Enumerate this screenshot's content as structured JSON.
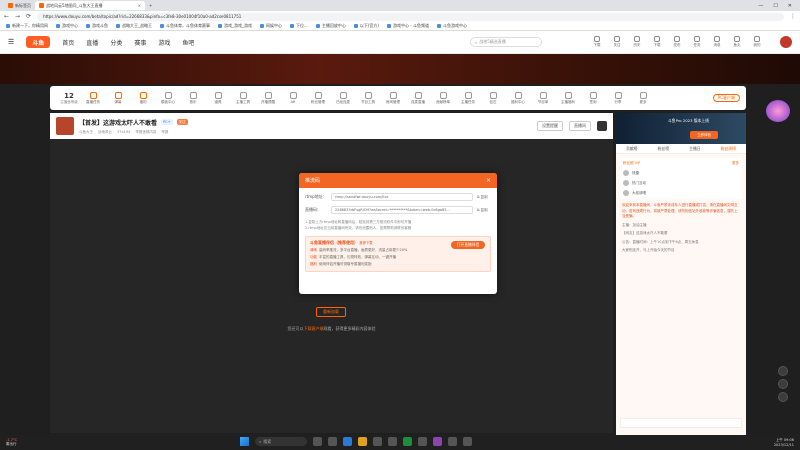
{
  "browser": {
    "tabs": [
      {
        "label": "新标签页",
        "active": false
      },
      {
        "label": "战地风云5地图问_斗鱼大王直播",
        "active": true
      },
      {
        "label": "+",
        "active": false
      }
    ],
    "url": "https://www.douyu.com/beta/topic/ad?rid=2266833&pinfo=c3fe8-30e01004f10a0-ad2cse0811751",
    "bookmarks": [
      "新建一下，你精用网",
      "游戏中心",
      "游戏斗鱼",
      "战略大王_战略王",
      "斗鱼体育，斗鱼体育赛事",
      "游戏_游戏_游戏",
      "网娱中心",
      "下位...",
      "主播回放中心",
      "以下(官方)",
      "游戏中心 - 斗鱼频道",
      "斗鱼游戏中心"
    ]
  },
  "site": {
    "logo": "斗鱼",
    "nav": [
      "首页",
      "直播",
      "分类",
      "赛事",
      "游戏",
      "鱼吧"
    ],
    "search_placeholder": "战地5精选直播",
    "header_icons": [
      "下载",
      "关注",
      "历史",
      "下载",
      "发布",
      "任务",
      "消息",
      "鱼丸",
      "我的"
    ]
  },
  "toolbar": {
    "level": "12",
    "level_label": "主播鱼等级",
    "tools": [
      "直播任务",
      "弹幕",
      "福利",
      "模板中心",
      "音乐",
      "道具",
      "主播工具",
      "开播提醒",
      "AR",
      "粉丝管理",
      "已经连麦",
      "节目工具",
      "房间管理",
      "连麦直播",
      "贡献榜单",
      "主播任务",
      "钻石",
      "福利中心",
      "节目单",
      "主播福利",
      "签到",
      "分享",
      "更多"
    ],
    "pc_button": "PC客户端"
  },
  "room": {
    "title": "【首发】这游戏太吓人不敢看",
    "tag_blue": "PC+",
    "tag_orange": "关注",
    "meta": [
      "斗鱼大王",
      "战地风云",
      "374194",
      "举报违规内容"
    ],
    "report_label": "举报",
    "btn_notify": "设置提醒",
    "btn_record": "直播间",
    "btn_share": "分享"
  },
  "player": {
    "retry": "重新加载",
    "hint_prefix": "您还可以",
    "hint_link": "下载客户端",
    "hint_suffix": "观看，获得更多精彩内容体验"
  },
  "modal": {
    "title": "推流码",
    "close": "×",
    "rtmp_label": "rtmp地址:",
    "rtmp_value": "rtmp://sendfwr.douyu.com/live",
    "key_label": "直播码:",
    "key_value": "2266833rbFsgRiOH?wsSecret=**********&token=web-0c8ga83...",
    "copy1": "复制",
    "copy2": "复制",
    "notes": [
      "1.复制上方rtmp地址和直播码后，粘贴到第三方推流软件中即可开播",
      "2.rtmp地址仅当前直播间有效，请勿泄露他人，如需帮助请联系客服"
    ],
    "promo_title": "斗鱼直播伴侣（推荐使用）",
    "promo_badge": "推荐下载",
    "promo_lines": [
      {
        "k": "清晰",
        "v": "高码率推流，多平台直播，画质更好，流量占用更少20%"
      },
      {
        "k": "功能",
        "v": "丰富的直播工具，礼物特效，弹幕互动，一键开播"
      },
      {
        "k": "福利",
        "v": "使用伴侣开播可领取专属福利奖励"
      }
    ],
    "promo_button": "打开直播伴侣"
  },
  "chat": {
    "ad_text": "斗鱼Pro 2023 版本上线",
    "ad_button": "立即体验",
    "tabs": [
      "贡献榜",
      "粉丝榜",
      "主播日",
      "粉丝周榜"
    ],
    "rank_header": "粉丝团 VIP",
    "rank_more": "更多",
    "rank_rows": [
      "快捷",
      "热门互动",
      "大叔请喝"
    ],
    "system_msg": "欢迎来到本直播间，斗鱼严禁未成年人进行直播或打赏，请在直播间文明互动，若有违规行为，将被严肃处理。请勿相信站外收款等诈骗信息，谨防上当受骗。",
    "messages": [
      "主播：加油主播",
      "【网友】这游戏太吓人不敢看",
      "公告：直播时间：上午10点到下午6点，周五休息",
      "大家别走开，马上开始今天的节目"
    ]
  },
  "taskbar": {
    "weather_city": "雾出行",
    "weather_temp": "-1.7°C",
    "search": "搜索",
    "time": "上午 09:06",
    "date": "2023/12/11"
  }
}
